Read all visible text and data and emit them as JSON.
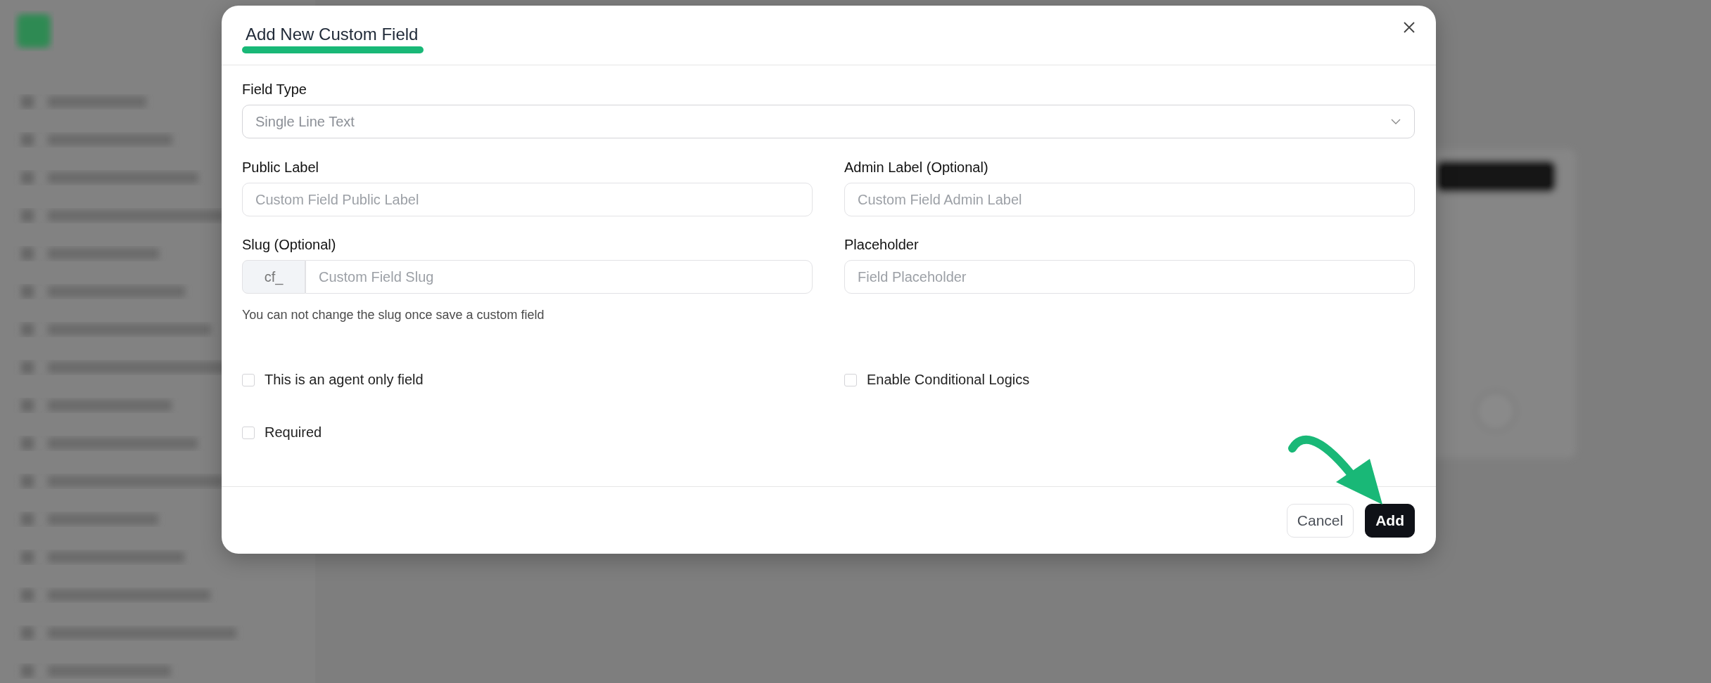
{
  "dialog": {
    "title": "Add New Custom Field",
    "field_type": {
      "label": "Field Type",
      "value": "Single Line Text"
    },
    "fields": [
      {
        "label": "Public Label",
        "placeholder": "Custom Field Public Label"
      },
      {
        "label": "Admin Label (Optional)",
        "placeholder": "Custom Field Admin Label"
      },
      {
        "label": "Slug (Optional)",
        "prefix": "cf_",
        "placeholder": "Custom Field Slug",
        "help": "You can not change the slug once save a custom field"
      },
      {
        "label": "Placeholder",
        "placeholder": "Field Placeholder"
      }
    ],
    "checkboxes": [
      {
        "label": "This is an agent only field",
        "checked": false
      },
      {
        "label": "Enable Conditional Logics",
        "checked": false
      },
      {
        "label": "Required",
        "checked": false
      }
    ],
    "buttons": [
      {
        "label": "Cancel",
        "kind": "secondary"
      },
      {
        "label": "Add",
        "kind": "primary"
      }
    ]
  }
}
